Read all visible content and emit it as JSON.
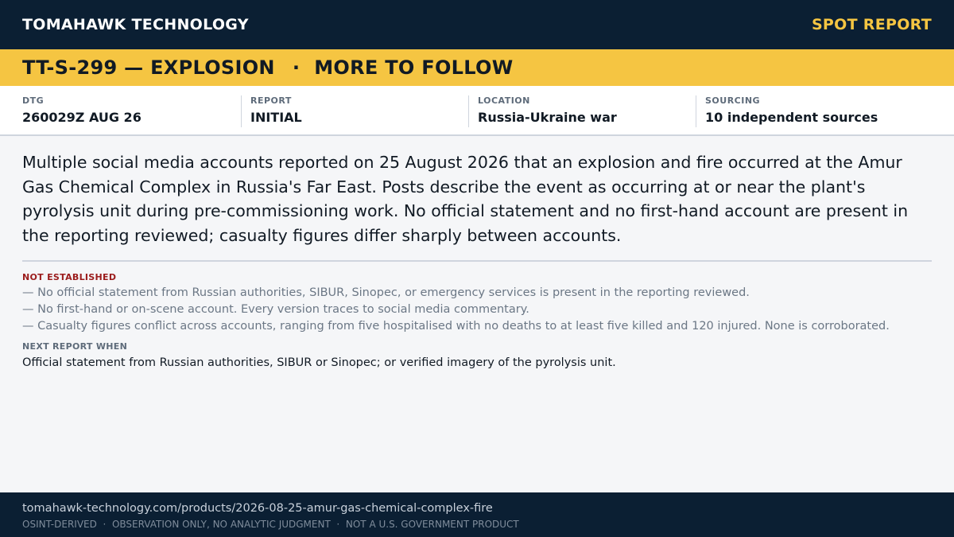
{
  "header": {
    "brand": "TOMAHAWK TECHNOLOGY",
    "report_type": "SPOT REPORT"
  },
  "headline": {
    "id_subject": "TT-S-299 — EXPLOSION",
    "separator": "·",
    "status": "MORE TO FOLLOW"
  },
  "meta": {
    "dtg": {
      "label": "DTG",
      "value": "260029Z AUG 26"
    },
    "report": {
      "label": "REPORT",
      "value": "INITIAL"
    },
    "location": {
      "label": "LOCATION",
      "value": "Russia-Ukraine war"
    },
    "sourcing": {
      "label": "SOURCING",
      "value": "10 independent sources"
    }
  },
  "summary": "Multiple social media accounts reported on 25 August 2026 that an explosion and fire occurred at the Amur Gas Chemical Complex in Russia's Far East. Posts describe the event as occurring at or near the plant's pyrolysis unit during pre-commissioning work. No official statement and no first-hand account are present in the reporting reviewed; casualty figures differ sharply between accounts.",
  "not_established": {
    "title": "NOT ESTABLISHED",
    "items": [
      "— No official statement from Russian authorities, SIBUR, Sinopec, or emergency services is present in the reporting reviewed.",
      "— No first-hand or on-scene account. Every version traces to social media commentary.",
      "— Casualty figures conflict across accounts, ranging from five hospitalised with no deaths to at least five killed and 120 injured. None is corroborated."
    ]
  },
  "next_report": {
    "title": "NEXT REPORT WHEN",
    "text": "Official statement from Russian authorities, SIBUR or Sinopec; or verified imagery of the pyrolysis unit."
  },
  "footer": {
    "url": "tomahawk-technology.com/products/2026-08-25-amur-gas-chemical-complex-fire",
    "tags": "OSINT-DERIVED  ·  OBSERVATION ONLY, NO ANALYTIC JUDGMENT  ·  NOT A U.S. GOVERNMENT PRODUCT"
  },
  "colors": {
    "navy": "#0b1f33",
    "accent_yellow": "#f5c542",
    "alert_red": "#9b1c1c",
    "background": "#f5f6f8"
  }
}
